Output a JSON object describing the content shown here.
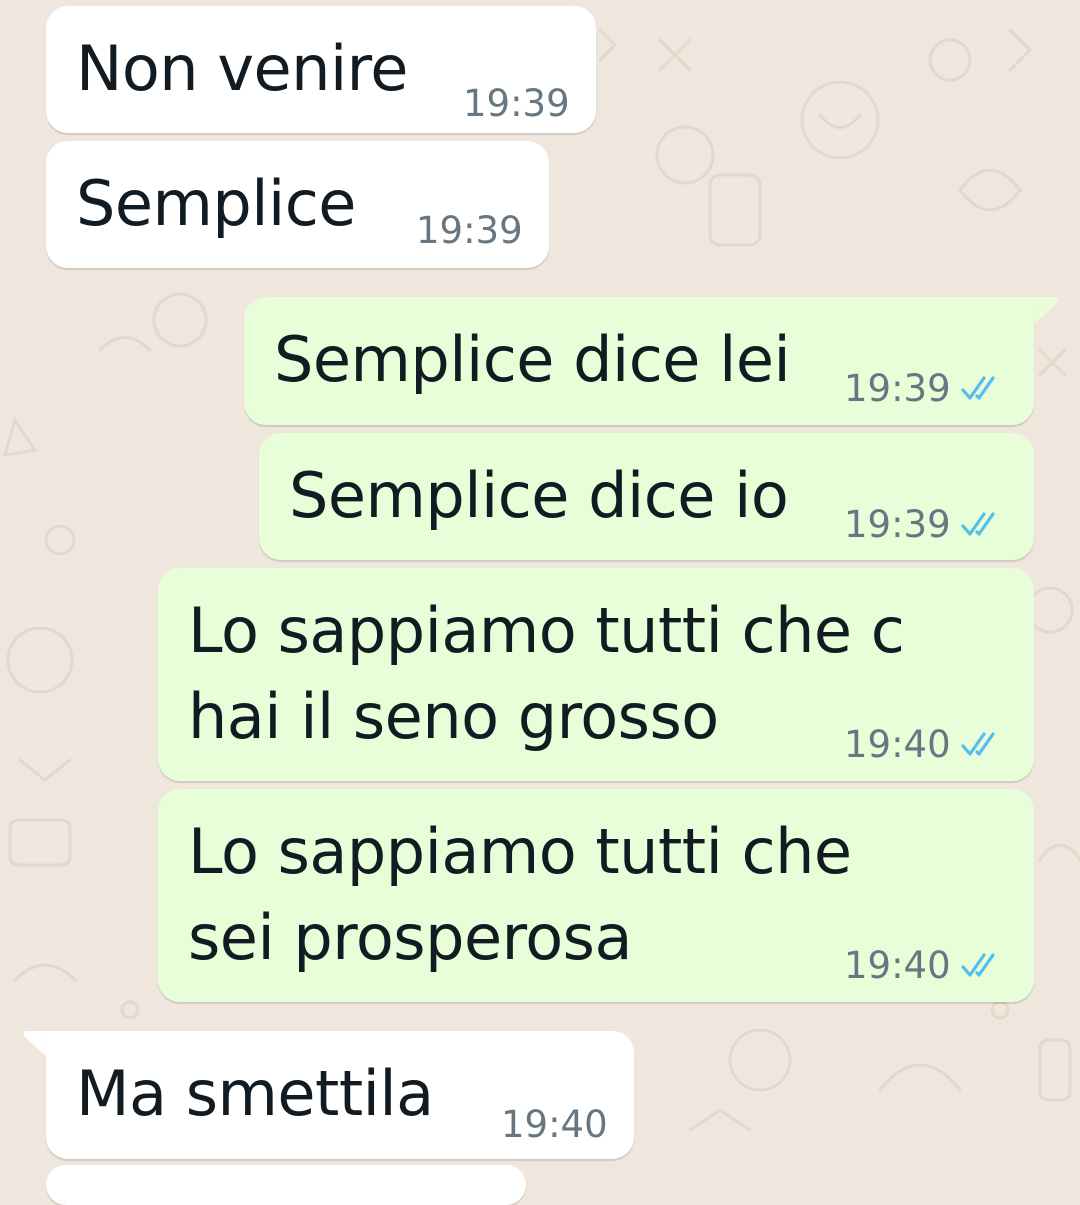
{
  "messages": [
    {
      "direction": "incoming",
      "text": "Non venire",
      "time": "19:39"
    },
    {
      "direction": "incoming",
      "text": "Semplice",
      "time": "19:39"
    },
    {
      "direction": "outgoing",
      "text": "Semplice dice lei",
      "time": "19:39",
      "status": "read"
    },
    {
      "direction": "outgoing",
      "text": "Semplice dice io",
      "time": "19:39",
      "status": "read"
    },
    {
      "direction": "outgoing",
      "lines": [
        "Lo sappiamo tutti che c",
        "hai il seno grosso"
      ],
      "time": "19:40",
      "status": "read"
    },
    {
      "direction": "outgoing",
      "lines": [
        "Lo sappiamo tutti che",
        "sei prosperosa"
      ],
      "time": "19:40",
      "status": "read"
    },
    {
      "direction": "incoming",
      "text": "Ma smettila",
      "time": "19:40"
    }
  ],
  "colors": {
    "background": "#efe7de",
    "incoming_bubble": "#ffffff",
    "outgoing_bubble": "#e7fed8",
    "text": "#111b21",
    "timestamp": "#667781",
    "read_ticks": "#53bdeb"
  },
  "icons": {
    "read_status": "double-check-icon"
  }
}
